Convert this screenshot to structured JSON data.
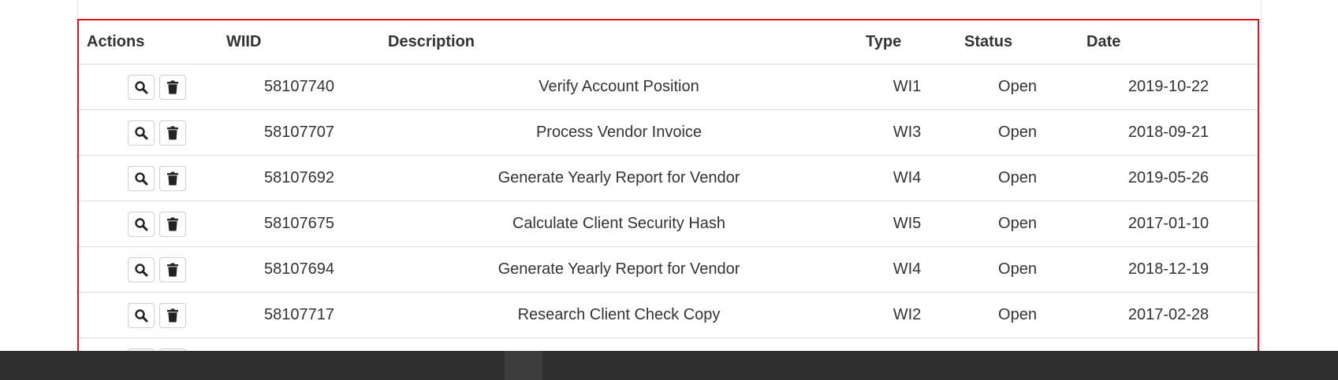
{
  "table": {
    "headers": {
      "actions": "Actions",
      "wiid": "WIID",
      "description": "Description",
      "type": "Type",
      "status": "Status",
      "date": "Date"
    },
    "rows": [
      {
        "wiid": "58107740",
        "description": "Verify Account Position",
        "type": "WI1",
        "status": "Open",
        "date": "2019-10-22"
      },
      {
        "wiid": "58107707",
        "description": "Process Vendor Invoice",
        "type": "WI3",
        "status": "Open",
        "date": "2018-09-21"
      },
      {
        "wiid": "58107692",
        "description": "Generate Yearly Report for Vendor",
        "type": "WI4",
        "status": "Open",
        "date": "2019-05-26"
      },
      {
        "wiid": "58107675",
        "description": "Calculate Client Security Hash",
        "type": "WI5",
        "status": "Open",
        "date": "2017-01-10"
      },
      {
        "wiid": "58107694",
        "description": "Generate Yearly Report for Vendor",
        "type": "WI4",
        "status": "Open",
        "date": "2018-12-19"
      },
      {
        "wiid": "58107717",
        "description": "Research Client Check Copy",
        "type": "WI2",
        "status": "Open",
        "date": "2017-02-28"
      }
    ]
  },
  "icons": {
    "view": "search-icon",
    "delete": "trash-icon"
  },
  "colors": {
    "highlight_border": "#e0141e",
    "footer": "#2f2f2f"
  }
}
